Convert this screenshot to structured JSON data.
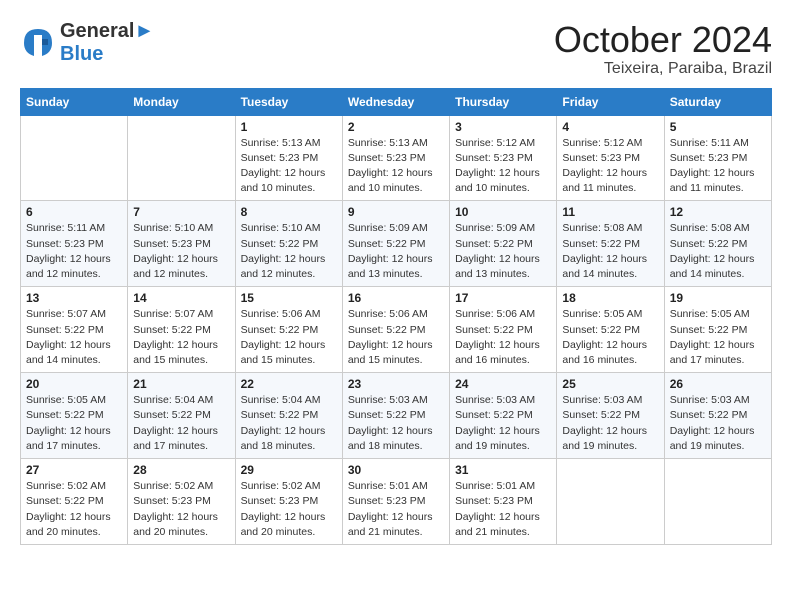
{
  "header": {
    "logo_line1": "General",
    "logo_line2": "Blue",
    "month": "October 2024",
    "location": "Teixeira, Paraiba, Brazil"
  },
  "weekdays": [
    "Sunday",
    "Monday",
    "Tuesday",
    "Wednesday",
    "Thursday",
    "Friday",
    "Saturday"
  ],
  "weeks": [
    [
      {
        "day": "",
        "info": ""
      },
      {
        "day": "",
        "info": ""
      },
      {
        "day": "1",
        "info": "Sunrise: 5:13 AM\nSunset: 5:23 PM\nDaylight: 12 hours\nand 10 minutes."
      },
      {
        "day": "2",
        "info": "Sunrise: 5:13 AM\nSunset: 5:23 PM\nDaylight: 12 hours\nand 10 minutes."
      },
      {
        "day": "3",
        "info": "Sunrise: 5:12 AM\nSunset: 5:23 PM\nDaylight: 12 hours\nand 10 minutes."
      },
      {
        "day": "4",
        "info": "Sunrise: 5:12 AM\nSunset: 5:23 PM\nDaylight: 12 hours\nand 11 minutes."
      },
      {
        "day": "5",
        "info": "Sunrise: 5:11 AM\nSunset: 5:23 PM\nDaylight: 12 hours\nand 11 minutes."
      }
    ],
    [
      {
        "day": "6",
        "info": "Sunrise: 5:11 AM\nSunset: 5:23 PM\nDaylight: 12 hours\nand 12 minutes."
      },
      {
        "day": "7",
        "info": "Sunrise: 5:10 AM\nSunset: 5:23 PM\nDaylight: 12 hours\nand 12 minutes."
      },
      {
        "day": "8",
        "info": "Sunrise: 5:10 AM\nSunset: 5:22 PM\nDaylight: 12 hours\nand 12 minutes."
      },
      {
        "day": "9",
        "info": "Sunrise: 5:09 AM\nSunset: 5:22 PM\nDaylight: 12 hours\nand 13 minutes."
      },
      {
        "day": "10",
        "info": "Sunrise: 5:09 AM\nSunset: 5:22 PM\nDaylight: 12 hours\nand 13 minutes."
      },
      {
        "day": "11",
        "info": "Sunrise: 5:08 AM\nSunset: 5:22 PM\nDaylight: 12 hours\nand 14 minutes."
      },
      {
        "day": "12",
        "info": "Sunrise: 5:08 AM\nSunset: 5:22 PM\nDaylight: 12 hours\nand 14 minutes."
      }
    ],
    [
      {
        "day": "13",
        "info": "Sunrise: 5:07 AM\nSunset: 5:22 PM\nDaylight: 12 hours\nand 14 minutes."
      },
      {
        "day": "14",
        "info": "Sunrise: 5:07 AM\nSunset: 5:22 PM\nDaylight: 12 hours\nand 15 minutes."
      },
      {
        "day": "15",
        "info": "Sunrise: 5:06 AM\nSunset: 5:22 PM\nDaylight: 12 hours\nand 15 minutes."
      },
      {
        "day": "16",
        "info": "Sunrise: 5:06 AM\nSunset: 5:22 PM\nDaylight: 12 hours\nand 15 minutes."
      },
      {
        "day": "17",
        "info": "Sunrise: 5:06 AM\nSunset: 5:22 PM\nDaylight: 12 hours\nand 16 minutes."
      },
      {
        "day": "18",
        "info": "Sunrise: 5:05 AM\nSunset: 5:22 PM\nDaylight: 12 hours\nand 16 minutes."
      },
      {
        "day": "19",
        "info": "Sunrise: 5:05 AM\nSunset: 5:22 PM\nDaylight: 12 hours\nand 17 minutes."
      }
    ],
    [
      {
        "day": "20",
        "info": "Sunrise: 5:05 AM\nSunset: 5:22 PM\nDaylight: 12 hours\nand 17 minutes."
      },
      {
        "day": "21",
        "info": "Sunrise: 5:04 AM\nSunset: 5:22 PM\nDaylight: 12 hours\nand 17 minutes."
      },
      {
        "day": "22",
        "info": "Sunrise: 5:04 AM\nSunset: 5:22 PM\nDaylight: 12 hours\nand 18 minutes."
      },
      {
        "day": "23",
        "info": "Sunrise: 5:03 AM\nSunset: 5:22 PM\nDaylight: 12 hours\nand 18 minutes."
      },
      {
        "day": "24",
        "info": "Sunrise: 5:03 AM\nSunset: 5:22 PM\nDaylight: 12 hours\nand 19 minutes."
      },
      {
        "day": "25",
        "info": "Sunrise: 5:03 AM\nSunset: 5:22 PM\nDaylight: 12 hours\nand 19 minutes."
      },
      {
        "day": "26",
        "info": "Sunrise: 5:03 AM\nSunset: 5:22 PM\nDaylight: 12 hours\nand 19 minutes."
      }
    ],
    [
      {
        "day": "27",
        "info": "Sunrise: 5:02 AM\nSunset: 5:22 PM\nDaylight: 12 hours\nand 20 minutes."
      },
      {
        "day": "28",
        "info": "Sunrise: 5:02 AM\nSunset: 5:23 PM\nDaylight: 12 hours\nand 20 minutes."
      },
      {
        "day": "29",
        "info": "Sunrise: 5:02 AM\nSunset: 5:23 PM\nDaylight: 12 hours\nand 20 minutes."
      },
      {
        "day": "30",
        "info": "Sunrise: 5:01 AM\nSunset: 5:23 PM\nDaylight: 12 hours\nand 21 minutes."
      },
      {
        "day": "31",
        "info": "Sunrise: 5:01 AM\nSunset: 5:23 PM\nDaylight: 12 hours\nand 21 minutes."
      },
      {
        "day": "",
        "info": ""
      },
      {
        "day": "",
        "info": ""
      }
    ]
  ]
}
